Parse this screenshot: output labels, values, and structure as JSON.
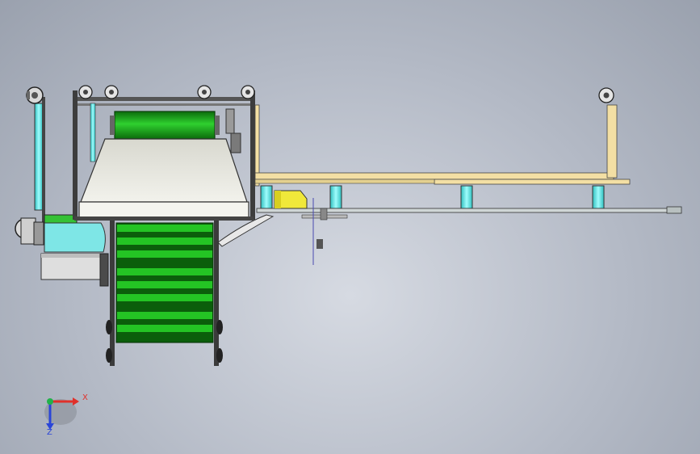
{
  "scene": {
    "colors": {
      "background": "#b4bac6",
      "belt_green": "#1fb31f",
      "belt_dark": "#0b5e0b",
      "roller_green": "#16a016",
      "frame_cyan": "#6ff3f3",
      "wood_beam": "#f3dfa4",
      "cover_grey": "#e9e9e2",
      "yellow_carriage": "#f0e83a",
      "frame_dark": "#3b3b3b"
    }
  },
  "triad": {
    "x_label": "X",
    "z_label": "Z",
    "x_color": "#e0302a",
    "y_color": "#22b24a",
    "z_color": "#2a45d8"
  }
}
